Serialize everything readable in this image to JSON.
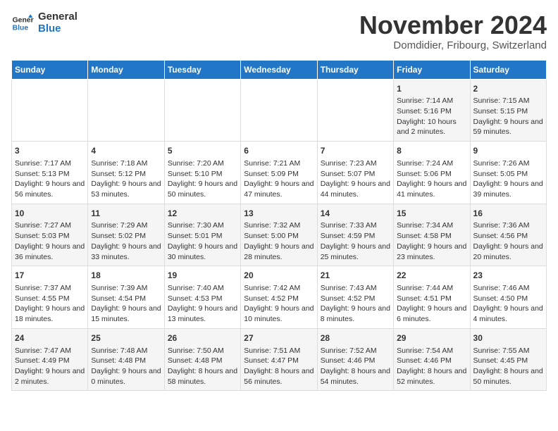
{
  "header": {
    "logo_line1": "General",
    "logo_line2": "Blue",
    "month": "November 2024",
    "location": "Domdidier, Fribourg, Switzerland"
  },
  "weekdays": [
    "Sunday",
    "Monday",
    "Tuesday",
    "Wednesday",
    "Thursday",
    "Friday",
    "Saturday"
  ],
  "rows": [
    [
      {
        "day": "",
        "content": ""
      },
      {
        "day": "",
        "content": ""
      },
      {
        "day": "",
        "content": ""
      },
      {
        "day": "",
        "content": ""
      },
      {
        "day": "",
        "content": ""
      },
      {
        "day": "1",
        "content": "Sunrise: 7:14 AM\nSunset: 5:16 PM\nDaylight: 10 hours and 2 minutes."
      },
      {
        "day": "2",
        "content": "Sunrise: 7:15 AM\nSunset: 5:15 PM\nDaylight: 9 hours and 59 minutes."
      }
    ],
    [
      {
        "day": "3",
        "content": "Sunrise: 7:17 AM\nSunset: 5:13 PM\nDaylight: 9 hours and 56 minutes."
      },
      {
        "day": "4",
        "content": "Sunrise: 7:18 AM\nSunset: 5:12 PM\nDaylight: 9 hours and 53 minutes."
      },
      {
        "day": "5",
        "content": "Sunrise: 7:20 AM\nSunset: 5:10 PM\nDaylight: 9 hours and 50 minutes."
      },
      {
        "day": "6",
        "content": "Sunrise: 7:21 AM\nSunset: 5:09 PM\nDaylight: 9 hours and 47 minutes."
      },
      {
        "day": "7",
        "content": "Sunrise: 7:23 AM\nSunset: 5:07 PM\nDaylight: 9 hours and 44 minutes."
      },
      {
        "day": "8",
        "content": "Sunrise: 7:24 AM\nSunset: 5:06 PM\nDaylight: 9 hours and 41 minutes."
      },
      {
        "day": "9",
        "content": "Sunrise: 7:26 AM\nSunset: 5:05 PM\nDaylight: 9 hours and 39 minutes."
      }
    ],
    [
      {
        "day": "10",
        "content": "Sunrise: 7:27 AM\nSunset: 5:03 PM\nDaylight: 9 hours and 36 minutes."
      },
      {
        "day": "11",
        "content": "Sunrise: 7:29 AM\nSunset: 5:02 PM\nDaylight: 9 hours and 33 minutes."
      },
      {
        "day": "12",
        "content": "Sunrise: 7:30 AM\nSunset: 5:01 PM\nDaylight: 9 hours and 30 minutes."
      },
      {
        "day": "13",
        "content": "Sunrise: 7:32 AM\nSunset: 5:00 PM\nDaylight: 9 hours and 28 minutes."
      },
      {
        "day": "14",
        "content": "Sunrise: 7:33 AM\nSunset: 4:59 PM\nDaylight: 9 hours and 25 minutes."
      },
      {
        "day": "15",
        "content": "Sunrise: 7:34 AM\nSunset: 4:58 PM\nDaylight: 9 hours and 23 minutes."
      },
      {
        "day": "16",
        "content": "Sunrise: 7:36 AM\nSunset: 4:56 PM\nDaylight: 9 hours and 20 minutes."
      }
    ],
    [
      {
        "day": "17",
        "content": "Sunrise: 7:37 AM\nSunset: 4:55 PM\nDaylight: 9 hours and 18 minutes."
      },
      {
        "day": "18",
        "content": "Sunrise: 7:39 AM\nSunset: 4:54 PM\nDaylight: 9 hours and 15 minutes."
      },
      {
        "day": "19",
        "content": "Sunrise: 7:40 AM\nSunset: 4:53 PM\nDaylight: 9 hours and 13 minutes."
      },
      {
        "day": "20",
        "content": "Sunrise: 7:42 AM\nSunset: 4:52 PM\nDaylight: 9 hours and 10 minutes."
      },
      {
        "day": "21",
        "content": "Sunrise: 7:43 AM\nSunset: 4:52 PM\nDaylight: 9 hours and 8 minutes."
      },
      {
        "day": "22",
        "content": "Sunrise: 7:44 AM\nSunset: 4:51 PM\nDaylight: 9 hours and 6 minutes."
      },
      {
        "day": "23",
        "content": "Sunrise: 7:46 AM\nSunset: 4:50 PM\nDaylight: 9 hours and 4 minutes."
      }
    ],
    [
      {
        "day": "24",
        "content": "Sunrise: 7:47 AM\nSunset: 4:49 PM\nDaylight: 9 hours and 2 minutes."
      },
      {
        "day": "25",
        "content": "Sunrise: 7:48 AM\nSunset: 4:48 PM\nDaylight: 9 hours and 0 minutes."
      },
      {
        "day": "26",
        "content": "Sunrise: 7:50 AM\nSunset: 4:48 PM\nDaylight: 8 hours and 58 minutes."
      },
      {
        "day": "27",
        "content": "Sunrise: 7:51 AM\nSunset: 4:47 PM\nDaylight: 8 hours and 56 minutes."
      },
      {
        "day": "28",
        "content": "Sunrise: 7:52 AM\nSunset: 4:46 PM\nDaylight: 8 hours and 54 minutes."
      },
      {
        "day": "29",
        "content": "Sunrise: 7:54 AM\nSunset: 4:46 PM\nDaylight: 8 hours and 52 minutes."
      },
      {
        "day": "30",
        "content": "Sunrise: 7:55 AM\nSunset: 4:45 PM\nDaylight: 8 hours and 50 minutes."
      }
    ]
  ]
}
